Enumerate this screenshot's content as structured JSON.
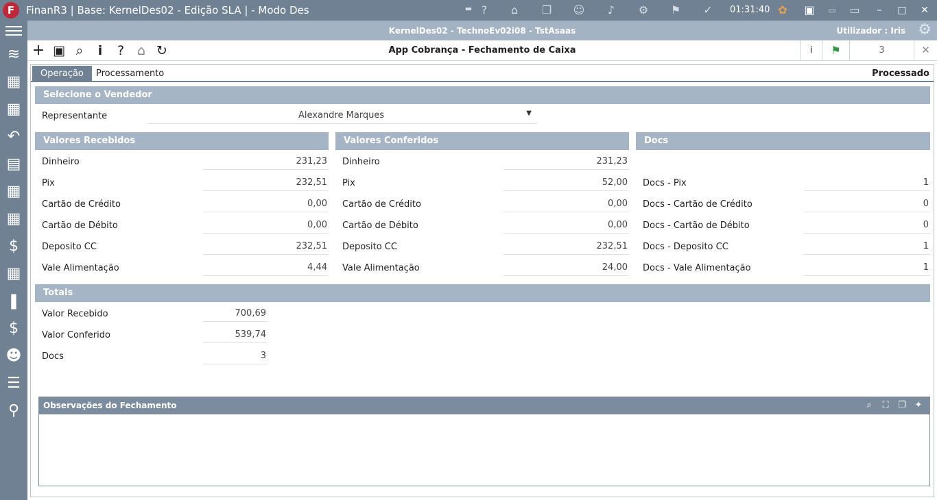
{
  "titlebar": {
    "logo": "F",
    "title": "FinanR3 | Base: KernelDes02 - Edição SLA | - Modo Des",
    "clock": "01:31:40",
    "icons": [
      "help-icon",
      "bank-icon",
      "windows-icon",
      "user-icon",
      "bell-icon",
      "gear-icon",
      "flag-icon",
      "check-icon",
      "color-wheel-icon",
      "camera-icon",
      "monitor-small-icon",
      "monitor-icon"
    ],
    "minimize": "–",
    "maximize": "□",
    "close": "✕"
  },
  "infobar": {
    "center": "KernelDes02 - TechnoEv02i08 - TstAsaas",
    "user": "Utilizador : Iris"
  },
  "toolbar": {
    "title": "App Cobrança - Fechamento de Caixa",
    "info": "i",
    "counter": "3"
  },
  "tabs": {
    "operacao": "Operação",
    "processamento": "Processamento",
    "status": "Processado"
  },
  "vendedor": {
    "header": "Selecione o Vendedor",
    "label": "Representante",
    "value": "Alexandre Marques"
  },
  "recebidos": {
    "header": "Valores Recebidos",
    "rows": [
      {
        "label": "Dinheiro",
        "value": "231,23"
      },
      {
        "label": "Pix",
        "value": "232,51"
      },
      {
        "label": "Cartão de Crédito",
        "value": "0,00"
      },
      {
        "label": "Cartão de Débito",
        "value": "0,00"
      },
      {
        "label": "Deposito CC",
        "value": "232,51"
      },
      {
        "label": "Vale Alimentação",
        "value": "4,44"
      }
    ]
  },
  "conferidos": {
    "header": "Valores Conferidos",
    "rows": [
      {
        "label": "Dinheiro",
        "value": "231,23"
      },
      {
        "label": "Pix",
        "value": "52,00"
      },
      {
        "label": "Cartão de Crédito",
        "value": "0,00"
      },
      {
        "label": "Cartão de Débito",
        "value": "0,00"
      },
      {
        "label": "Deposito CC",
        "value": "232,51"
      },
      {
        "label": "Vale Alimentação",
        "value": "24,00"
      }
    ]
  },
  "docs": {
    "header": "Docs",
    "rows": [
      {
        "label": "Docs - Pix",
        "value": "1"
      },
      {
        "label": "Docs - Cartão de Crédito",
        "value": "0"
      },
      {
        "label": "Docs - Cartão de Débito",
        "value": "0"
      },
      {
        "label": "Docs - Deposito CC",
        "value": "1"
      },
      {
        "label": "Docs - Vale Alimentação",
        "value": "1"
      }
    ]
  },
  "totais": {
    "header": "Totais",
    "rows": [
      {
        "label": "Valor Recebido",
        "value": "700,69"
      },
      {
        "label": "Valor Conferido",
        "value": "539,74"
      },
      {
        "label": "Docs",
        "value": "3"
      }
    ]
  },
  "observacoes": {
    "header": "Observações do Fechamento"
  }
}
